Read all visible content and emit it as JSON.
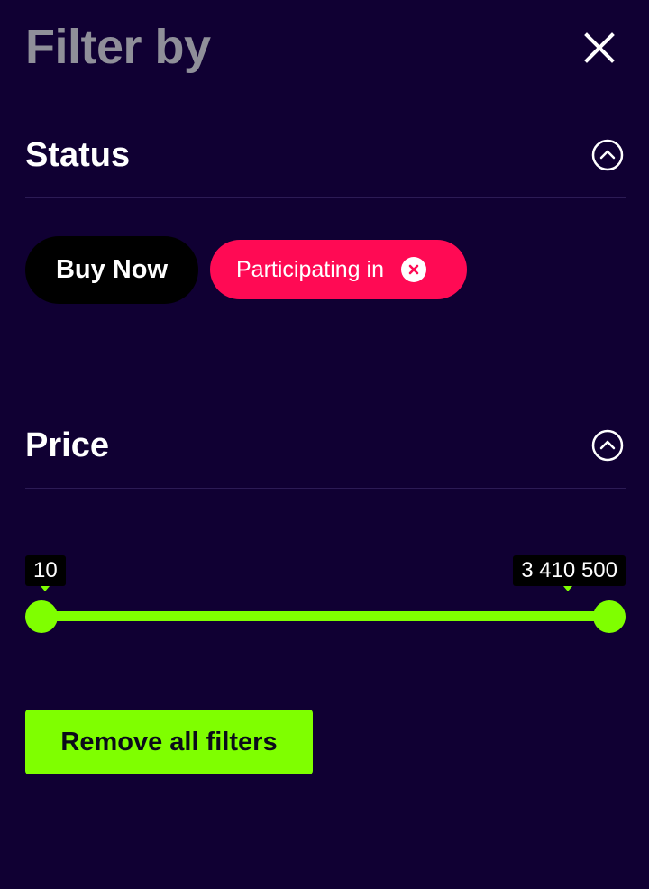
{
  "header": {
    "title": "Filter by"
  },
  "sections": {
    "status": {
      "label": "Status",
      "chips": {
        "buy_now": "Buy Now",
        "participating": "Participating in"
      }
    },
    "price": {
      "label": "Price",
      "min_value": "10",
      "max_value": "3 410 500",
      "range_fraction": [
        0.0,
        1.0
      ]
    }
  },
  "footer": {
    "remove_all_label": "Remove all filters"
  },
  "colors": {
    "background": "#100033",
    "accent": "#7fff00",
    "chip_active": "#ff0a54",
    "title": "#8f8f99"
  },
  "icons": {
    "close": "close-icon",
    "collapse": "chevron-up-icon",
    "chip_remove": "x-circle-icon"
  }
}
